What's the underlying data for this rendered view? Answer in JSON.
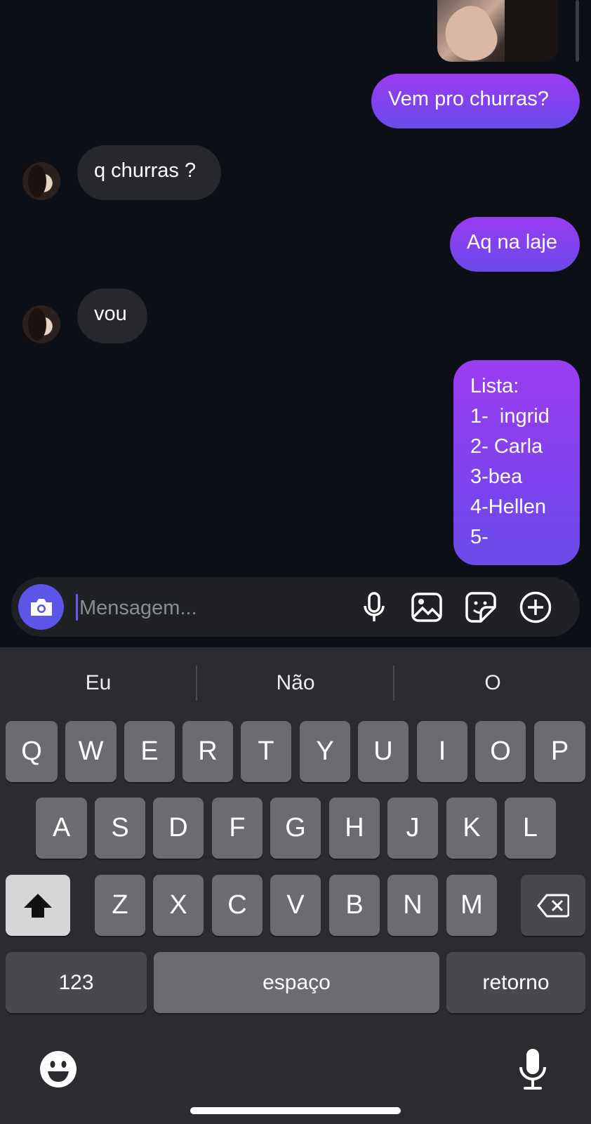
{
  "messages": [
    {
      "from": "me",
      "text": "Vem pro churras?"
    },
    {
      "from": "contact",
      "text": "q churras ?"
    },
    {
      "from": "me",
      "text": "Aq na laje"
    },
    {
      "from": "contact",
      "text": "vou"
    },
    {
      "from": "me",
      "text": "Lista:\n1-  ingrid\n2- Carla\n3-bea\n4-Hellen\n5-"
    }
  ],
  "composer": {
    "placeholder": "Mensagem...",
    "icons": [
      "camera-icon",
      "microphone-icon",
      "image-icon",
      "sticker-icon",
      "plus-icon"
    ]
  },
  "keyboard": {
    "suggestions": [
      "Eu",
      "Não",
      "O"
    ],
    "row1": [
      "Q",
      "W",
      "E",
      "R",
      "T",
      "Y",
      "U",
      "I",
      "O",
      "P"
    ],
    "row2": [
      "A",
      "S",
      "D",
      "F",
      "G",
      "H",
      "J",
      "K",
      "L"
    ],
    "row3": [
      "Z",
      "X",
      "C",
      "V",
      "B",
      "N",
      "M"
    ],
    "numbers_label": "123",
    "space_label": "espaço",
    "return_label": "retorno"
  },
  "colors": {
    "background": "#0c0f15",
    "outgoing_bubble_top": "#9b3cf0",
    "outgoing_bubble_bottom": "#6a4be8",
    "incoming_bubble": "#26282c",
    "accent": "#5b55e8",
    "keyboard_bg": "#2b2c2f",
    "key": "#6b6c6f"
  }
}
